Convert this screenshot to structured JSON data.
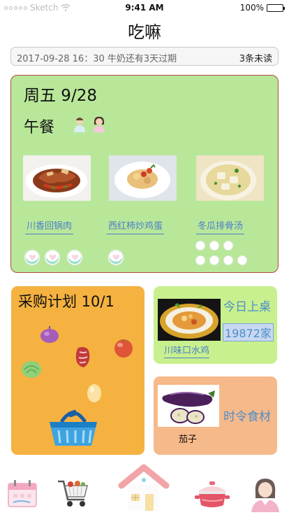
{
  "status_bar": {
    "carrier": "Sketch",
    "time": "9:41 AM",
    "battery": "100%",
    "battery_level": 1.0
  },
  "title": "吃嘛",
  "notice": {
    "text": "2017-09-28 16：30 牛奶还有3天过期",
    "count": "3条未读"
  },
  "meal": {
    "date": "周五 9/28",
    "meal_type": "午餐",
    "dishes": [
      {
        "name": "川香回锅肉",
        "icon": "twice-cooked-pork-photo",
        "ratings": 3
      },
      {
        "name": "西红柿炒鸡蛋",
        "icon": "tomato-egg-photo",
        "ratings": 1
      },
      {
        "name": "冬瓜排骨汤",
        "icon": "winter-melon-soup-photo",
        "ratings": 7
      }
    ]
  },
  "plan": {
    "title": "采购计划 10/1",
    "items": [
      "onion",
      "cabbage",
      "meat",
      "tomato",
      "egg",
      "basket"
    ]
  },
  "today": {
    "label": "今日上桌",
    "count": "19872家",
    "dish": "川味口水鸡"
  },
  "season": {
    "label": "时令食材",
    "item": "茄子"
  },
  "tabs": [
    "calendar-icon",
    "cart-icon",
    "home-icon",
    "pot-icon",
    "profile-icon"
  ],
  "colors": {
    "meal_bg": "#b9e79a",
    "plan_bg": "#f5b240",
    "today_bg": "#c8f08e",
    "season_bg": "#f6b98a",
    "link": "#4c7fc9"
  }
}
